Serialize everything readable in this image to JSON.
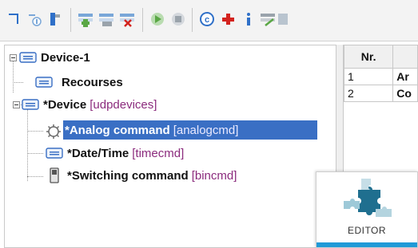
{
  "toolbar": {
    "buttons": [
      {
        "name": "collapse-tree-icon"
      },
      {
        "name": "new-item-icon"
      },
      {
        "name": "clipboard-icon"
      },
      {
        "name": "add-row-icon"
      },
      {
        "name": "edit-row-icon"
      },
      {
        "name": "delete-row-icon"
      },
      {
        "name": "run-icon"
      },
      {
        "name": "stop-icon"
      },
      {
        "name": "copyright-icon"
      },
      {
        "name": "add-red-icon"
      },
      {
        "name": "info-icon"
      },
      {
        "name": "export-icon"
      }
    ],
    "colors": {
      "green": "#5aa745",
      "gray": "#9aa3ab",
      "red": "#d3231e",
      "blue": "#2f70c8"
    }
  },
  "tree": {
    "root": {
      "label": "Device-1"
    },
    "resources": {
      "label": "Recourses"
    },
    "device": {
      "label": "*Device",
      "type": "[udpdevices]"
    },
    "analog": {
      "label": "*Analog command",
      "type": "[analogcmd]"
    },
    "datetime": {
      "label": "*Date/Time",
      "type": "[timecmd]"
    },
    "switching": {
      "label": "*Switching command",
      "type": "[bincmd]"
    }
  },
  "grid": {
    "columns": [
      "Nr.",
      ""
    ],
    "rows": [
      {
        "nr": "1",
        "name": "Ar"
      },
      {
        "nr": "2",
        "name": "Co"
      }
    ]
  },
  "editor_tile": {
    "caption": "EDITOR",
    "accent": "#1f9ad7"
  }
}
